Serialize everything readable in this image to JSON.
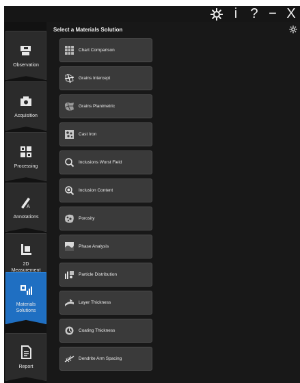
{
  "window": {
    "controls": {
      "info": "i",
      "help": "?",
      "minimize": "−",
      "close": "X"
    }
  },
  "nav": {
    "items": [
      {
        "label": "Observation",
        "icon": "microscope-icon"
      },
      {
        "label": "Acquisition",
        "icon": "camera-icon"
      },
      {
        "label": "Processing",
        "icon": "processing-grid-icon"
      },
      {
        "label": "Annotations",
        "icon": "annotation-pen-icon"
      },
      {
        "label": "2D\nMeasurement",
        "icon": "measurement-ruler-icon"
      },
      {
        "label": "Materials\nSolutions",
        "icon": "materials-chart-icon",
        "active": true
      },
      {
        "label": "Report",
        "icon": "report-document-icon"
      }
    ]
  },
  "content": {
    "title": "Select a Materials Solution",
    "solutions": [
      {
        "label": "Chart Comparison",
        "icon": "chart-comparison-icon"
      },
      {
        "label": "Grains Intercept",
        "icon": "grains-intercept-icon"
      },
      {
        "label": "Grains Planimetric",
        "icon": "grains-planimetric-icon"
      },
      {
        "label": "Cast Iron",
        "icon": "cast-iron-icon"
      },
      {
        "label": "Inclusions Worst Field",
        "icon": "inclusions-worst-field-icon"
      },
      {
        "label": "Inclusion Content",
        "icon": "inclusion-content-icon"
      },
      {
        "label": "Porosity",
        "icon": "porosity-icon"
      },
      {
        "label": "Phase Analysis",
        "icon": "phase-analysis-icon"
      },
      {
        "label": "Particle Distribution",
        "icon": "particle-distribution-icon"
      },
      {
        "label": "Layer Thickness",
        "icon": "layer-thickness-icon"
      },
      {
        "label": "Coating Thickness",
        "icon": "coating-thickness-icon"
      },
      {
        "label": "Dendrite Arm Spacing",
        "icon": "dendrite-arm-spacing-icon"
      }
    ]
  },
  "colors": {
    "accent": "#1f6fc2",
    "background": "#181818",
    "button": "#3a3a3a",
    "text": "#ececec"
  }
}
